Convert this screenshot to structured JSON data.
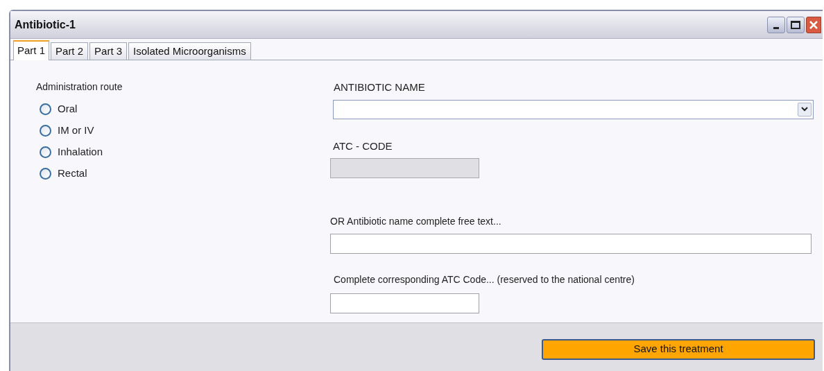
{
  "window": {
    "title": "Antibiotic-1"
  },
  "tabs": [
    {
      "label": "Part 1",
      "selected": true
    },
    {
      "label": "Part 2",
      "selected": false
    },
    {
      "label": "Part 3",
      "selected": false
    },
    {
      "label": "Isolated Microorganisms",
      "selected": false
    }
  ],
  "administration_route": {
    "label": "Administration route",
    "options": [
      {
        "label": "Oral",
        "selected": false
      },
      {
        "label": "IM or IV",
        "selected": false
      },
      {
        "label": "Inhalation",
        "selected": false
      },
      {
        "label": "Rectal",
        "selected": false
      }
    ]
  },
  "antibiotic_name": {
    "label": "ANTIBIOTIC NAME"
  },
  "atc_code": {
    "label": "ATC - CODE",
    "disabled": true
  },
  "free_text_name": {
    "label": "OR Antibiotic name complete free text..."
  },
  "corresponding_atc": {
    "label": "Complete corresponding ATC Code... (reserved to the national centre)"
  },
  "save_button": {
    "label": "Save this treatment"
  }
}
